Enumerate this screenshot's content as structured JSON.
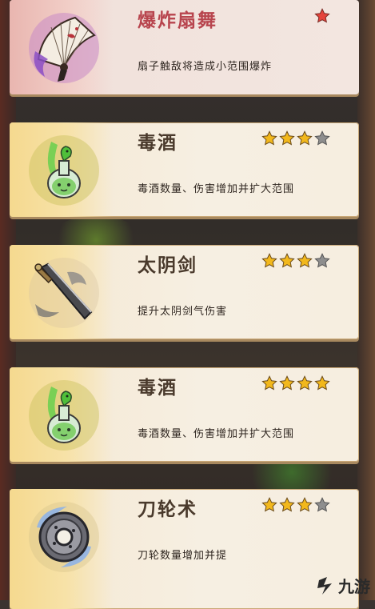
{
  "cards": [
    {
      "title": "爆炸扇舞",
      "desc": "扇子触敌将造成小范围爆炸",
      "stars_filled": 1,
      "stars_total": 1,
      "icon": "fan-icon"
    },
    {
      "title": "毒酒",
      "desc": "毒酒数量、伤害增加并扩大范围",
      "stars_filled": 3,
      "stars_total": 4,
      "icon": "poison-bottle-icon"
    },
    {
      "title": "太阴剑",
      "desc": "提升太阴剑气伤害",
      "stars_filled": 3,
      "stars_total": 4,
      "icon": "sword-icon"
    },
    {
      "title": "毒酒",
      "desc": "毒酒数量、伤害增加并扩大范围",
      "stars_filled": 4,
      "stars_total": 4,
      "icon": "poison-bottle-icon"
    },
    {
      "title": "刀轮术",
      "desc": "刀轮数量增加并提",
      "stars_filled": 3,
      "stars_total": 4,
      "icon": "blade-wheel-icon"
    }
  ],
  "watermark": {
    "text": "九游"
  },
  "colors": {
    "star_gold": "#f2b81c",
    "star_grey": "#8e8e8e",
    "star_red": "#e5433b"
  }
}
